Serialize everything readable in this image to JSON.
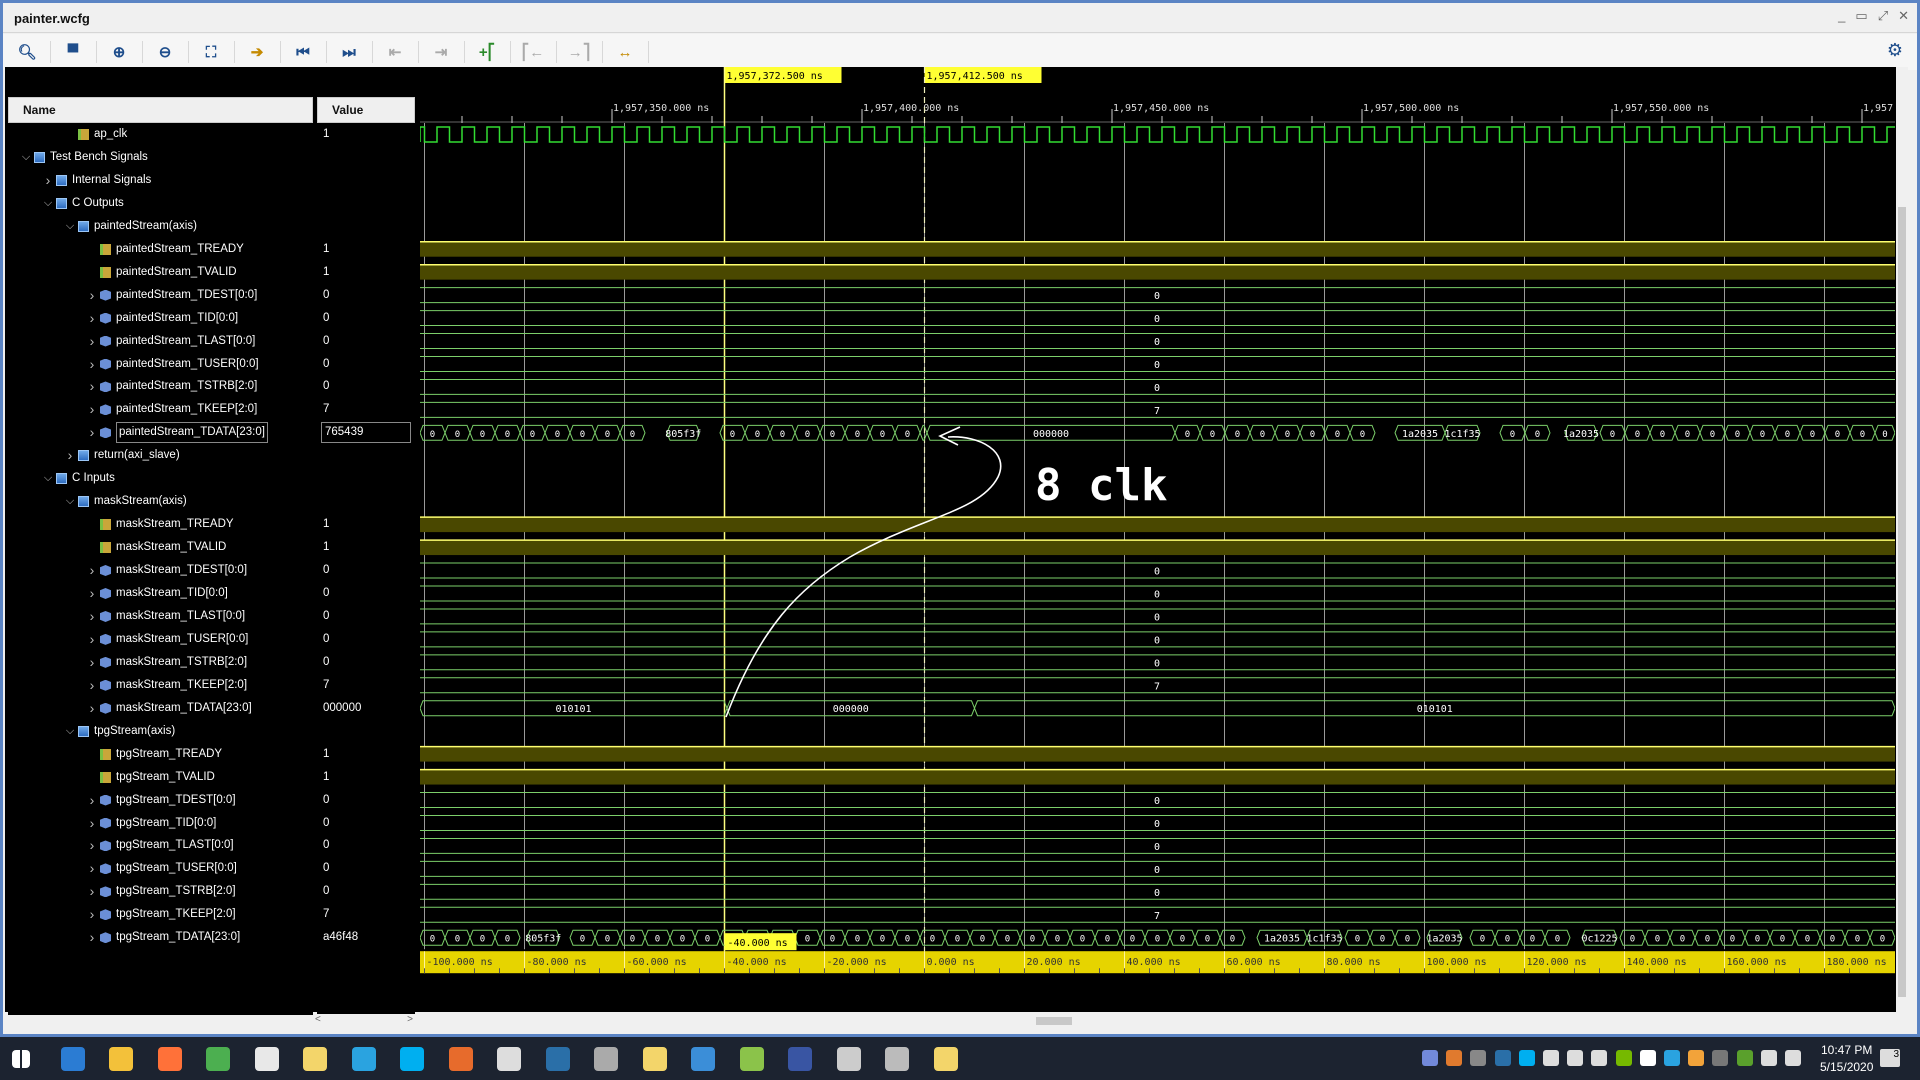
{
  "window": {
    "title": "painter.wcfg",
    "controls": [
      "_",
      "▭",
      "⤢",
      "✕"
    ]
  },
  "toolbar": [
    {
      "icon": "search-icon",
      "glyph": "🔍︎",
      "cls": ""
    },
    {
      "icon": "save-icon",
      "glyph": "▀",
      "cls": ""
    },
    {
      "icon": "zoom-in-icon",
      "glyph": "⊕",
      "cls": ""
    },
    {
      "icon": "zoom-out-icon",
      "glyph": "⊖",
      "cls": ""
    },
    {
      "icon": "zoom-fit-icon",
      "glyph": "⛶",
      "cls": ""
    },
    {
      "icon": "go-to-cursor-icon",
      "glyph": "➔",
      "cls": "o"
    },
    {
      "icon": "go-to-start-icon",
      "glyph": "⏮",
      "cls": ""
    },
    {
      "icon": "go-to-end-icon",
      "glyph": "⏭",
      "cls": ""
    },
    {
      "icon": "previous-transition-icon",
      "glyph": "⇤",
      "cls": "dis"
    },
    {
      "icon": "next-transition-icon",
      "glyph": "⇥",
      "cls": "dis"
    },
    {
      "icon": "add-marker-icon",
      "glyph": "+⎡",
      "cls": "g"
    },
    {
      "icon": "previous-marker-icon",
      "glyph": "⎡←",
      "cls": "dis"
    },
    {
      "icon": "next-marker-icon",
      "glyph": "→⎤",
      "cls": "dis"
    },
    {
      "icon": "swap-cursors-icon",
      "glyph": "↔",
      "cls": "o"
    }
  ],
  "columns": {
    "name": "Name",
    "value": "Value"
  },
  "rows": [
    {
      "name": "ap_clk",
      "value": "1",
      "level": 2,
      "icon": "clk",
      "exp": null,
      "wave": "clk"
    },
    {
      "name": "Test Bench Signals",
      "value": "",
      "level": 0,
      "icon": "group",
      "exp": "open",
      "wave": "none"
    },
    {
      "name": "Internal Signals",
      "value": "",
      "level": 1,
      "icon": "group",
      "exp": "closed",
      "wave": "none"
    },
    {
      "name": "C Outputs",
      "value": "",
      "level": 1,
      "icon": "group",
      "exp": "open",
      "wave": "none"
    },
    {
      "name": "paintedStream(axis)",
      "value": "",
      "level": 2,
      "icon": "group",
      "exp": "open",
      "wave": "none"
    },
    {
      "name": "paintedStream_TREADY",
      "value": "1",
      "level": 3,
      "icon": "bit",
      "exp": null,
      "wave": "high"
    },
    {
      "name": "paintedStream_TVALID",
      "value": "1",
      "level": 3,
      "icon": "bit",
      "exp": null,
      "wave": "high"
    },
    {
      "name": "paintedStream_TDEST[0:0]",
      "value": "0",
      "level": 3,
      "icon": "bus",
      "exp": "closed",
      "wave": "bus",
      "label": "0"
    },
    {
      "name": "paintedStream_TID[0:0]",
      "value": "0",
      "level": 3,
      "icon": "bus",
      "exp": "closed",
      "wave": "bus",
      "label": "0"
    },
    {
      "name": "paintedStream_TLAST[0:0]",
      "value": "0",
      "level": 3,
      "icon": "bus",
      "exp": "closed",
      "wave": "bus",
      "label": "0"
    },
    {
      "name": "paintedStream_TUSER[0:0]",
      "value": "0",
      "level": 3,
      "icon": "bus",
      "exp": "closed",
      "wave": "bus",
      "label": "0"
    },
    {
      "name": "paintedStream_TSTRB[2:0]",
      "value": "0",
      "level": 3,
      "icon": "bus",
      "exp": "closed",
      "wave": "bus",
      "label": "0"
    },
    {
      "name": "paintedStream_TKEEP[2:0]",
      "value": "7",
      "level": 3,
      "icon": "bus",
      "exp": "closed",
      "wave": "bus",
      "label": "7"
    },
    {
      "name": "paintedStream_TDATA[23:0]",
      "value": "765439",
      "level": 3,
      "icon": "bus",
      "exp": "closed",
      "wave": "busy",
      "selected": true,
      "busy_ranges": [
        [
          1957311.6,
          1957413
        ],
        [
          1957462.6,
          1957606.6
        ]
      ],
      "segments": [
        [
          1957361,
          1957367.5,
          "805f3f"
        ],
        [
          1957413,
          1957462.6,
          "000000"
        ],
        [
          1957506.6,
          1957516.6,
          "1a2035"
        ],
        [
          1957516.6,
          1957523.6,
          "1c1f35"
        ],
        [
          1957540.6,
          1957547,
          "1a2035"
        ]
      ]
    },
    {
      "name": "return(axi_slave)",
      "value": "",
      "level": 2,
      "icon": "group",
      "exp": "closed",
      "wave": "none"
    },
    {
      "name": "C Inputs",
      "value": "",
      "level": 1,
      "icon": "group",
      "exp": "open",
      "wave": "none"
    },
    {
      "name": "maskStream(axis)",
      "value": "",
      "level": 2,
      "icon": "group",
      "exp": "open",
      "wave": "none"
    },
    {
      "name": "maskStream_TREADY",
      "value": "1",
      "level": 3,
      "icon": "bit",
      "exp": null,
      "wave": "high"
    },
    {
      "name": "maskStream_TVALID",
      "value": "1",
      "level": 3,
      "icon": "bit",
      "exp": null,
      "wave": "high"
    },
    {
      "name": "maskStream_TDEST[0:0]",
      "value": "0",
      "level": 3,
      "icon": "bus",
      "exp": "closed",
      "wave": "bus",
      "label": "0"
    },
    {
      "name": "maskStream_TID[0:0]",
      "value": "0",
      "level": 3,
      "icon": "bus",
      "exp": "closed",
      "wave": "bus",
      "label": "0"
    },
    {
      "name": "maskStream_TLAST[0:0]",
      "value": "0",
      "level": 3,
      "icon": "bus",
      "exp": "closed",
      "wave": "bus",
      "label": "0"
    },
    {
      "name": "maskStream_TUSER[0:0]",
      "value": "0",
      "level": 3,
      "icon": "bus",
      "exp": "closed",
      "wave": "bus",
      "label": "0"
    },
    {
      "name": "maskStream_TSTRB[2:0]",
      "value": "0",
      "level": 3,
      "icon": "bus",
      "exp": "closed",
      "wave": "bus",
      "label": "0"
    },
    {
      "name": "maskStream_TKEEP[2:0]",
      "value": "7",
      "level": 3,
      "icon": "bus",
      "exp": "closed",
      "wave": "bus",
      "label": "7"
    },
    {
      "name": "maskStream_TDATA[23:0]",
      "value": "000000",
      "level": 3,
      "icon": "bus",
      "exp": "closed",
      "wave": "busy",
      "busy_ranges": [],
      "segments": [
        [
          1957311.6,
          1957373,
          "010101"
        ],
        [
          1957373,
          1957422.5,
          "000000"
        ],
        [
          1957422.5,
          1957606.6,
          "010101"
        ]
      ]
    },
    {
      "name": "tpgStream(axis)",
      "value": "",
      "level": 2,
      "icon": "group",
      "exp": "open",
      "wave": "none"
    },
    {
      "name": "tpgStream_TREADY",
      "value": "1",
      "level": 3,
      "icon": "bit",
      "exp": null,
      "wave": "high"
    },
    {
      "name": "tpgStream_TVALID",
      "value": "1",
      "level": 3,
      "icon": "bit",
      "exp": null,
      "wave": "high"
    },
    {
      "name": "tpgStream_TDEST[0:0]",
      "value": "0",
      "level": 3,
      "icon": "bus",
      "exp": "closed",
      "wave": "bus",
      "label": "0"
    },
    {
      "name": "tpgStream_TID[0:0]",
      "value": "0",
      "level": 3,
      "icon": "bus",
      "exp": "closed",
      "wave": "bus",
      "label": "0"
    },
    {
      "name": "tpgStream_TLAST[0:0]",
      "value": "0",
      "level": 3,
      "icon": "bus",
      "exp": "closed",
      "wave": "bus",
      "label": "0"
    },
    {
      "name": "tpgStream_TUSER[0:0]",
      "value": "0",
      "level": 3,
      "icon": "bus",
      "exp": "closed",
      "wave": "bus",
      "label": "0"
    },
    {
      "name": "tpgStream_TSTRB[2:0]",
      "value": "0",
      "level": 3,
      "icon": "bus",
      "exp": "closed",
      "wave": "bus",
      "label": "0"
    },
    {
      "name": "tpgStream_TKEEP[2:0]",
      "value": "7",
      "level": 3,
      "icon": "bus",
      "exp": "closed",
      "wave": "bus",
      "label": "7"
    },
    {
      "name": "tpgStream_TDATA[23:0]",
      "value": "a46f48",
      "level": 3,
      "icon": "bus",
      "exp": "closed",
      "wave": "busy",
      "busy_ranges": [
        [
          1957311.6,
          1957606.6
        ]
      ],
      "segments": [
        [
          1957333,
          1957339.5,
          "805f3f"
        ],
        [
          1957479,
          1957489,
          "1a2035"
        ],
        [
          1957489,
          1957496,
          "1c1f35"
        ],
        [
          1957513,
          1957520,
          "1a2035"
        ],
        [
          1957544,
          1957551,
          "0c1225"
        ]
      ]
    }
  ],
  "timeline": {
    "unit": "ns",
    "view_start": 1957311.6,
    "view_end": 1957606.6,
    "clock_period": 5,
    "short_value": "0",
    "top_ticks": [
      "1,957,350.000 ns",
      "1,957,400.000 ns",
      "1,957,450.000 ns",
      "1,957,500.000 ns",
      "1,957,550.000 ns",
      "1,957"
    ],
    "top_tick_times": [
      1957350,
      1957400,
      1957450,
      1957500,
      1957550,
      1957600
    ],
    "cursors": [
      {
        "time": 1957372.5,
        "label": "1,957,372.500 ns"
      },
      {
        "time": 1957412.5,
        "label": "1,957,412.500 ns"
      }
    ],
    "relative_label": "-40.000 ns",
    "bottom_ticks": [
      "-100.000 ns",
      "-80.000 ns",
      "-60.000 ns",
      "-40.000 ns",
      "-20.000 ns",
      "0.000 ns",
      "20.000 ns",
      "40.000 ns",
      "60.000 ns",
      "80.000 ns",
      "100.000 ns",
      "120.000 ns",
      "140.000 ns",
      "160.000 ns",
      "180.000 ns"
    ],
    "colors": {
      "wave": "#33dd33",
      "bus": "#7ccf6a",
      "high_fill": "#4a4800",
      "high_line": "#ffff70",
      "cursor": "#ffff80",
      "grid": "#9a9a9a",
      "ruler": "#e6d400"
    }
  },
  "annotation": {
    "text": "8 clk"
  },
  "taskbar": {
    "apps": [
      [
        "start-icon",
        "#fff"
      ],
      [
        "edge-icon",
        "#2b7cd3"
      ],
      [
        "file-explorer-icon",
        "#f3c13a"
      ],
      [
        "firefox-icon",
        "#ff7139"
      ],
      [
        "chrome-icon",
        "#4caf50"
      ],
      [
        "excel-icon",
        "#e8e8e8"
      ],
      [
        "vivado-icon",
        "#f3d56a"
      ],
      [
        "telegram-icon",
        "#2aa3e0"
      ],
      [
        "skype-icon",
        "#00aff0"
      ],
      [
        "matlab-icon",
        "#e76b2c"
      ],
      [
        "calculator-icon",
        "#ddd"
      ],
      [
        "steam-icon",
        "#2a6fa8"
      ],
      [
        "app-icon",
        "#aaa"
      ],
      [
        "vivado-hls-icon",
        "#f3d56a"
      ],
      [
        "photos-icon",
        "#3b8ed8"
      ],
      [
        "notepad-icon",
        "#8bc34a"
      ],
      [
        "visio-icon",
        "#3955a3"
      ],
      [
        "app2-icon",
        "#ccc"
      ],
      [
        "app3-icon",
        "#bbb"
      ],
      [
        "vivado2-icon",
        "#f3d56a"
      ]
    ],
    "tray": [
      [
        "discord-icon",
        "#7289da"
      ],
      [
        "java-icon",
        "#e07a2e"
      ],
      [
        "app-tray-icon",
        "#888"
      ],
      [
        "steam-tray-icon",
        "#2a6fa8"
      ],
      [
        "skype-tray-icon",
        "#00aff0"
      ],
      [
        "network-drive-icon",
        "#ddd"
      ],
      [
        "window-icon",
        "#ddd"
      ],
      [
        "sync-icon",
        "#ddd"
      ],
      [
        "nvidia-icon",
        "#76b900"
      ],
      [
        "defender-icon",
        "#fff"
      ],
      [
        "telegram-tray-icon",
        "#2aa3e0"
      ],
      [
        "weather-icon",
        "#f2a33a"
      ],
      [
        "grid-icon",
        "#777"
      ],
      [
        "utorrent-icon",
        "#5aa02c"
      ],
      [
        "network-icon",
        "#ddd"
      ],
      [
        "volume-icon",
        "#ddd"
      ]
    ],
    "time": "10:47 PM",
    "date": "5/15/2020",
    "notifications": "3"
  }
}
